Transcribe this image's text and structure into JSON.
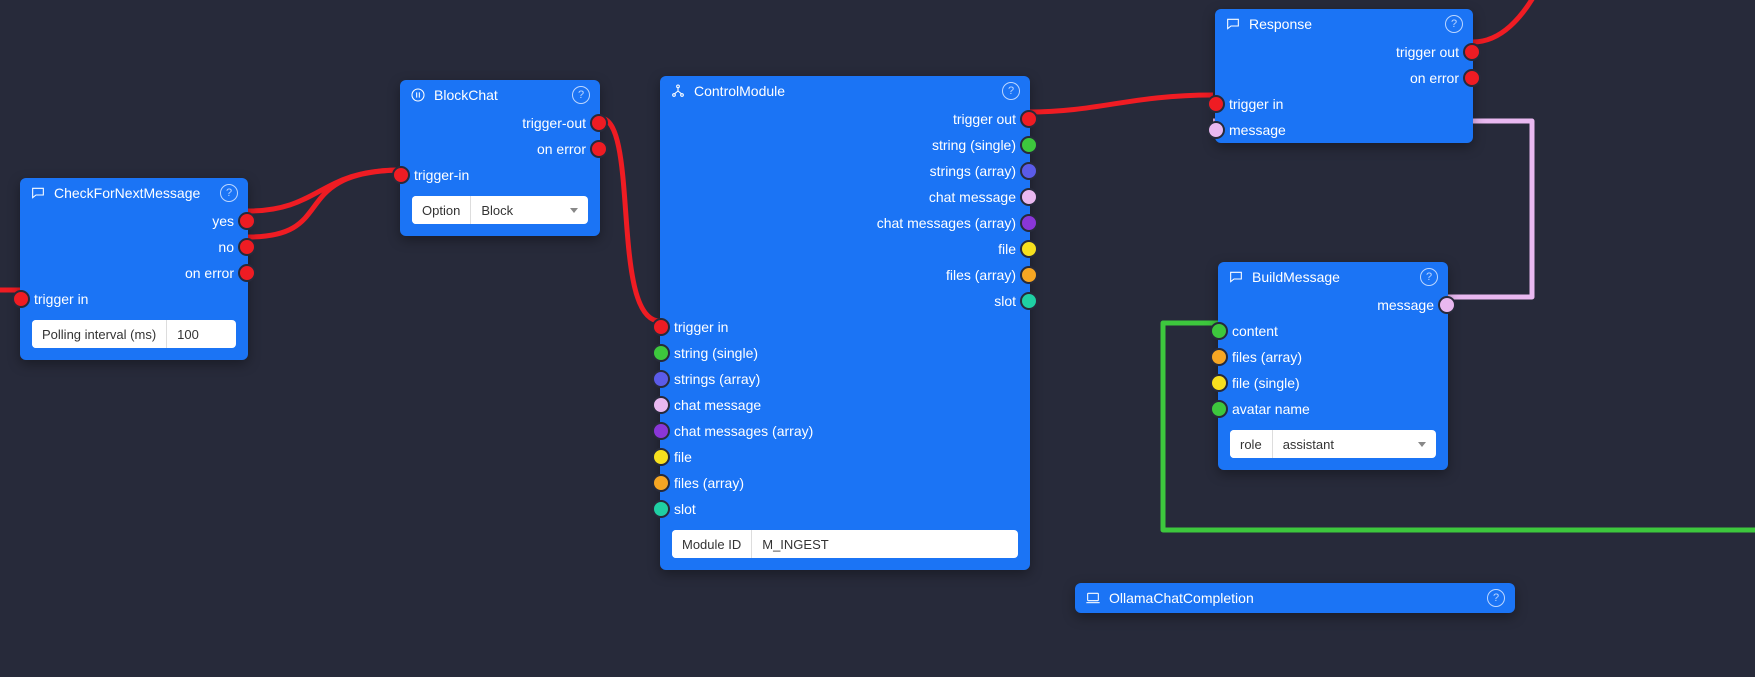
{
  "nodes": {
    "check": {
      "title": "CheckForNextMessage",
      "out": [
        "yes",
        "no",
        "on error"
      ],
      "in": [
        "trigger in"
      ],
      "field": {
        "label": "Polling interval (ms)",
        "value": "100"
      }
    },
    "block": {
      "title": "BlockChat",
      "out": [
        "trigger-out",
        "on error"
      ],
      "in": [
        "trigger-in"
      ],
      "field": {
        "label": "Option",
        "value": "Block"
      }
    },
    "control": {
      "title": "ControlModule",
      "out": [
        "trigger out",
        "string (single)",
        "strings (array)",
        "chat message",
        "chat messages (array)",
        "file",
        "files (array)",
        "slot"
      ],
      "in": [
        "trigger in",
        "string (single)",
        "strings (array)",
        "chat message",
        "chat messages (array)",
        "file",
        "files (array)",
        "slot"
      ],
      "field": {
        "label": "Module ID",
        "value": "M_INGEST"
      }
    },
    "response": {
      "title": "Response",
      "out": [
        "trigger out",
        "on error"
      ],
      "in": [
        "trigger in",
        "message"
      ]
    },
    "build": {
      "title": "BuildMessage",
      "out": [
        "message"
      ],
      "in": [
        "content",
        "files (array)",
        "file (single)",
        "avatar name"
      ],
      "field": {
        "label": "role",
        "value": "assistant"
      }
    },
    "ollama": {
      "title": "OllamaChatCompletion"
    }
  },
  "port_colors": {
    "trigger": "#ef1c23",
    "string": "#3dc73d",
    "string_array": "#5b5be8",
    "chat_message": "#e9b8f0",
    "chat_message_array": "#8a36d8",
    "file": "#f7e01e",
    "file_array": "#f6a623",
    "slot": "#1fcfa3"
  }
}
